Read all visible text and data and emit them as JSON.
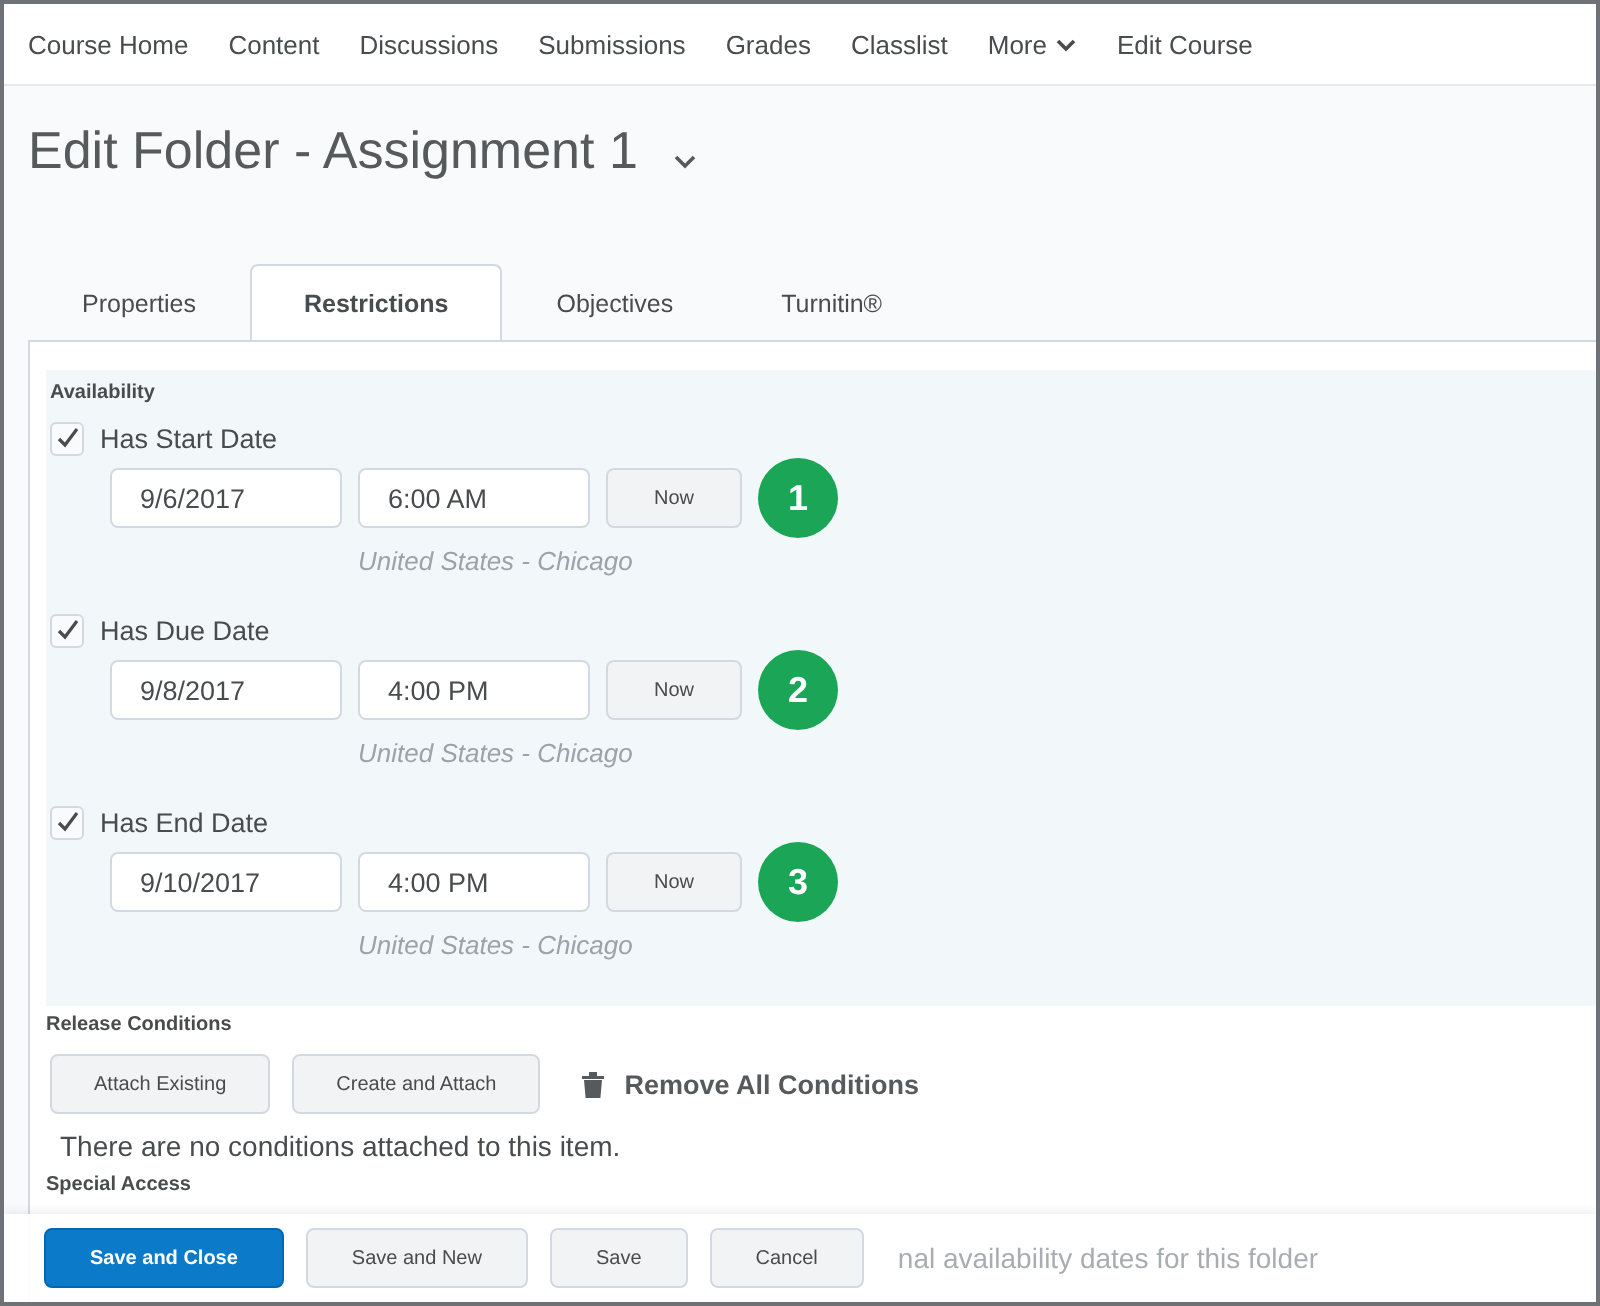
{
  "nav": [
    {
      "label": "Course Home",
      "has_menu": false
    },
    {
      "label": "Content",
      "has_menu": false
    },
    {
      "label": "Discussions",
      "has_menu": false
    },
    {
      "label": "Submissions",
      "has_menu": false
    },
    {
      "label": "Grades",
      "has_menu": false
    },
    {
      "label": "Classlist",
      "has_menu": false
    },
    {
      "label": "More",
      "has_menu": true
    },
    {
      "label": "Edit Course",
      "has_menu": false
    }
  ],
  "page_title": "Edit Folder - Assignment 1",
  "tabs": [
    {
      "label": "Properties",
      "selected": false
    },
    {
      "label": "Restrictions",
      "selected": true
    },
    {
      "label": "Objectives",
      "selected": false
    },
    {
      "label": "Turnitin®",
      "selected": false
    }
  ],
  "availability": {
    "heading": "Availability",
    "dates": [
      {
        "label": "Has Start Date",
        "checked": true,
        "date": "9/6/2017",
        "time": "6:00 AM",
        "now_button": "Now",
        "timezone": "United States - Chicago",
        "callout": "1"
      },
      {
        "label": "Has Due Date",
        "checked": true,
        "date": "9/8/2017",
        "time": "4:00 PM",
        "now_button": "Now",
        "timezone": "United States - Chicago",
        "callout": "2"
      },
      {
        "label": "Has End Date",
        "checked": true,
        "date": "9/10/2017",
        "time": "4:00 PM",
        "now_button": "Now",
        "timezone": "United States - Chicago",
        "callout": "3"
      }
    ]
  },
  "release_conditions": {
    "heading": "Release Conditions",
    "buttons": [
      "Attach Existing",
      "Create and Attach"
    ],
    "remove_all": "Remove All Conditions",
    "empty_message": "There are no conditions attached to this item."
  },
  "special_access": {
    "heading": "Special Access",
    "partial_text": "nal availability dates for this folder"
  },
  "footer": [
    {
      "label": "Save and Close",
      "primary": true
    },
    {
      "label": "Save and New",
      "primary": false
    },
    {
      "label": "Save",
      "primary": false
    },
    {
      "label": "Cancel",
      "primary": false
    }
  ]
}
